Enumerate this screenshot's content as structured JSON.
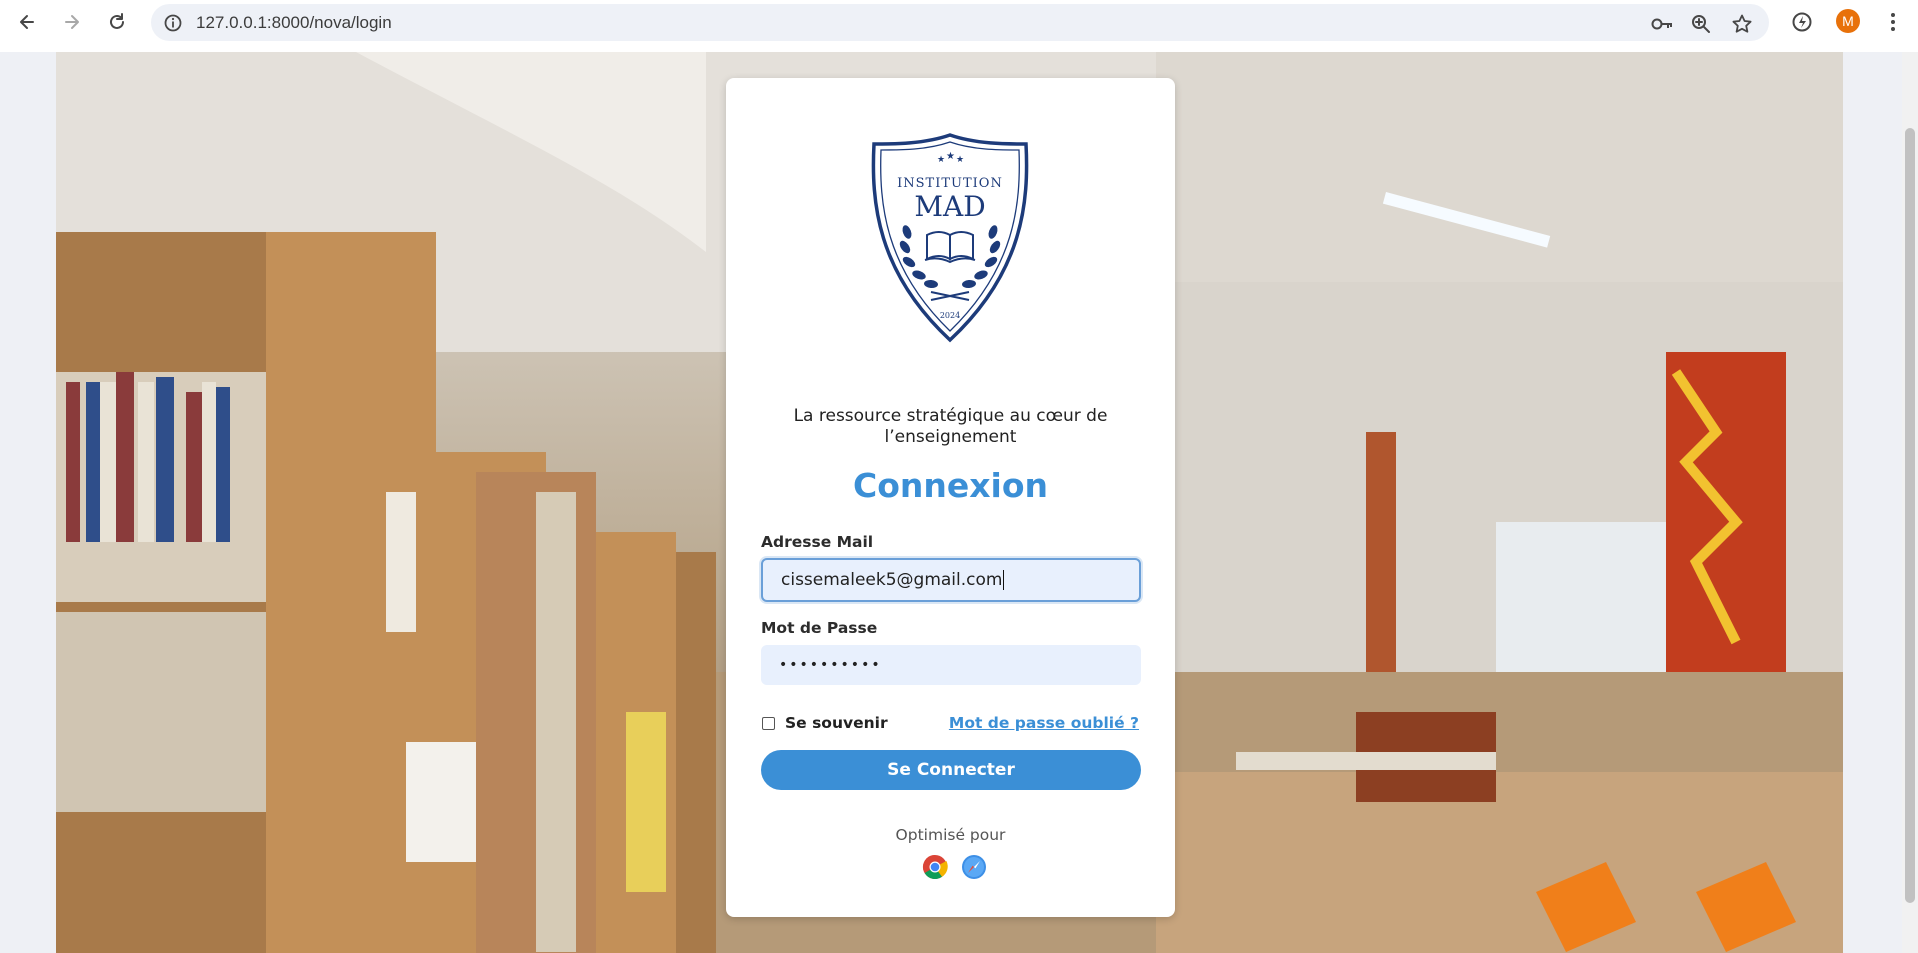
{
  "browser": {
    "url": "127.0.0.1:8000/nova/login",
    "profile_initial": "M",
    "icons": [
      "back-icon",
      "forward-icon",
      "reload-icon",
      "site-info-icon",
      "key-icon",
      "zoom-icon",
      "star-icon",
      "extension-icon",
      "profile-avatar",
      "menu-icon"
    ]
  },
  "logo": {
    "line1": "INSTITUTION",
    "line2": "MAD",
    "year": "2024"
  },
  "login": {
    "tagline": "La ressource stratégique au cœur de l’enseignement",
    "title": "Connexion",
    "email_label": "Adresse Mail",
    "email_value": "cissemaleek5@gmail.com",
    "password_label": "Mot de Passe",
    "password_value": "••••••••••",
    "remember_label": "Se souvenir",
    "forgot_label": "Mot de passe oublié ?",
    "submit_label": "Se Connecter",
    "optimized_label": "Optimisé pour",
    "optimized_browsers": [
      "chrome-icon",
      "safari-icon"
    ]
  },
  "colors": {
    "accent": "#3b8fd6",
    "input_bg": "#e8f0fd",
    "logo_navy": "#1d3b7a"
  }
}
